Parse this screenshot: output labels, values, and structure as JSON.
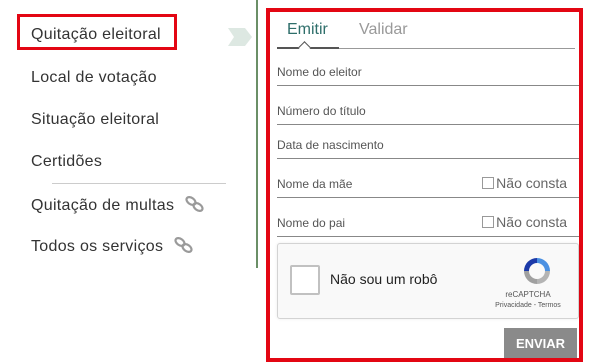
{
  "sidebar": {
    "items": [
      {
        "label": "Quitação eleitoral"
      },
      {
        "label": "Local de votação"
      },
      {
        "label": "Situação eleitoral"
      },
      {
        "label": "Certidões"
      },
      {
        "label": "Quitação de multas",
        "icon": "link-icon"
      },
      {
        "label": "Todos os serviços",
        "icon": "link-icon"
      }
    ],
    "highlight_color": "#e30613"
  },
  "form": {
    "tabs": [
      {
        "label": "Emitir"
      },
      {
        "label": "Validar"
      }
    ],
    "fields": [
      {
        "label": "Nome do eleitor"
      },
      {
        "label": "Número do título"
      },
      {
        "label": "Data de nascimento"
      },
      {
        "label": "Nome da mãe",
        "checkbox": "Não consta"
      },
      {
        "label": "Nome do pai",
        "checkbox": "Não consta"
      }
    ],
    "captcha": {
      "label": "Não sou um robô",
      "brand": "reCAPTCHA",
      "privacy": "Privacidade",
      "separator": " - ",
      "terms": "Termos"
    },
    "submit_label": "ENVIAR",
    "accent_color": "#2e6e6a"
  }
}
